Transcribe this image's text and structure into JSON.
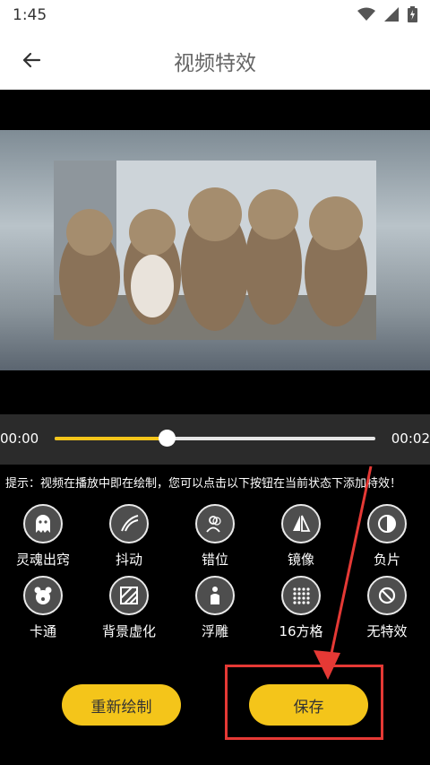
{
  "status": {
    "time": "1:45"
  },
  "header": {
    "title": "视频特效"
  },
  "player": {
    "time_current": "00:00",
    "time_total": "00:02",
    "progress": 0.35
  },
  "hint": "提示：视频在播放中即在绘制，您可以点击以下按钮在当前状态下添加特效！",
  "effects": [
    {
      "label": "灵魂出窍",
      "icon": "ghost-icon"
    },
    {
      "label": "抖动",
      "icon": "shake-icon"
    },
    {
      "label": "错位",
      "icon": "offset-person-icon"
    },
    {
      "label": "镜像",
      "icon": "mirror-icon"
    },
    {
      "label": "负片",
      "icon": "negative-icon"
    },
    {
      "label": "卡通",
      "icon": "bear-icon"
    },
    {
      "label": "背景虚化",
      "icon": "blur-icon"
    },
    {
      "label": "浮雕",
      "icon": "emboss-icon"
    },
    {
      "label": "16方格",
      "icon": "grid16-icon"
    },
    {
      "label": "无特效",
      "icon": "no-effect-icon"
    }
  ],
  "buttons": {
    "redraw": "重新绘制",
    "save": "保存"
  },
  "colors": {
    "accent": "#f4c51a",
    "annotation": "#e53935",
    "panel": "#2b2b2b"
  }
}
